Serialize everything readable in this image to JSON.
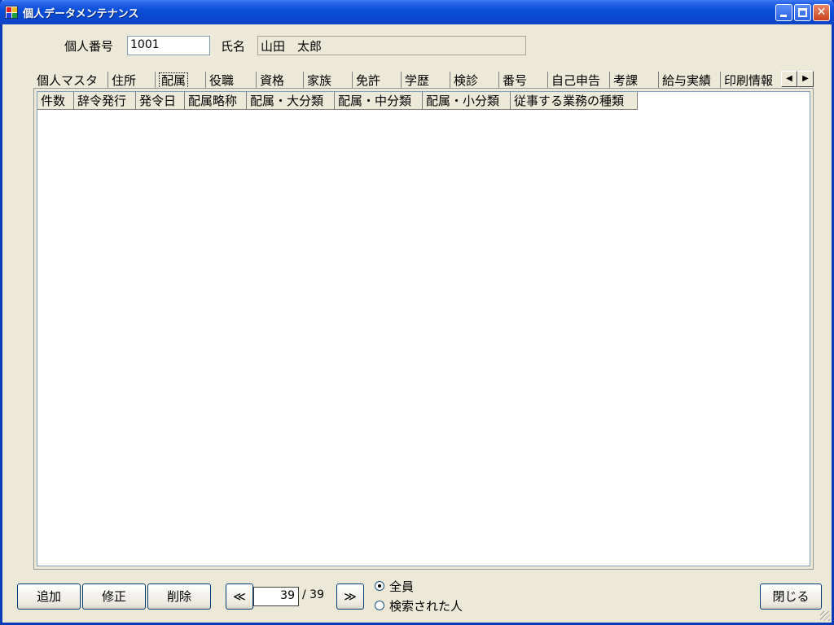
{
  "window": {
    "title": "個人データメンテナンス"
  },
  "form": {
    "id_label": "個人番号",
    "id_value": "1001",
    "name_label": "氏名",
    "name_value": "山田　太郎"
  },
  "tabs": [
    "個人マスタ",
    "住所",
    "配属",
    "役職",
    "資格",
    "家族",
    "免許",
    "学歴",
    "検診",
    "番号",
    "自己申告",
    "考課",
    "給与実績",
    "印刷情報"
  ],
  "active_tab": "配属",
  "columns": [
    "件数",
    "辞令発行",
    "発令日",
    "配属略称",
    "配属・大分類",
    "配属・中分類",
    "配属・小分類",
    "従事する業務の種類"
  ],
  "buttons": {
    "add": "追加",
    "edit": "修正",
    "delete": "削除",
    "close": "閉じる",
    "prev": "≪",
    "next": "≫"
  },
  "nav": {
    "current": "39",
    "total_text": "/ 39"
  },
  "filter": {
    "all_label": "全員",
    "searched_label": "検索された人",
    "selected": "all"
  },
  "icons": {
    "min": "minimize-icon",
    "max": "maximize-icon",
    "close": "close-icon"
  }
}
